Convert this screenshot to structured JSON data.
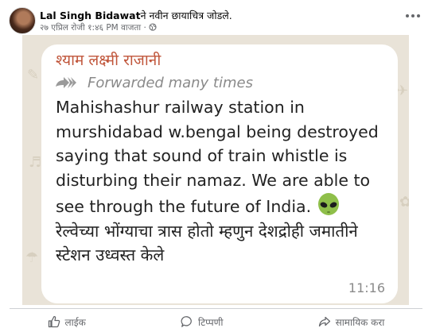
{
  "post": {
    "author": "Lal Singh Bidawat",
    "action_text": "ने नवीन छायाचित्र जोडले.",
    "timestamp": "२७ एप्रिल रोजी १:४६ PM वाजता",
    "separator": "·",
    "privacy_icon": "globe-icon",
    "more_icon": "more-options-icon"
  },
  "message": {
    "sender": "श्याम लक्ष्मी राजानी",
    "forwarded_label": "Forwarded many times",
    "text_en": "Mahishashur railway station in murshidabad w.bengal being destroyed saying that sound of train whistle is disturbing their namaz. We are able to see through the future of India.",
    "emoji": "alien-emoji",
    "text_mr": "रेल्वेच्या भोंग्याचा त्रास होतो म्हणुन देशद्रोही जमातीने स्टेशन उध्वस्त केले",
    "time": "11:16"
  },
  "actions": {
    "like": "लाईक",
    "comment": "टिप्पणी",
    "share": "सामायिक करा"
  },
  "colors": {
    "sender": "#c0553a",
    "bubble": "#ffffff",
    "chat_background": "#e9e3d8"
  }
}
